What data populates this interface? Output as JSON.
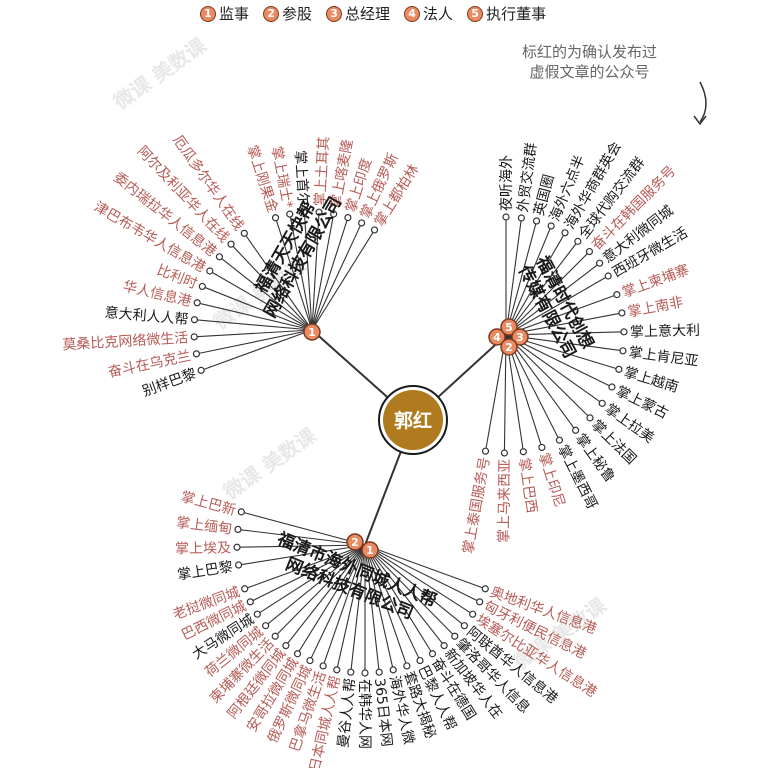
{
  "legend": [
    {
      "num": "1",
      "label": "监事"
    },
    {
      "num": "2",
      "label": "参股"
    },
    {
      "num": "3",
      "label": "总经理"
    },
    {
      "num": "4",
      "label": "法人"
    },
    {
      "num": "5",
      "label": "执行董事"
    }
  ],
  "note": [
    "标红的为确认发布过",
    "虚假文章的公众号"
  ],
  "center": {
    "label": "郭红"
  },
  "colors": {
    "red": "#b65b56",
    "black": "#1a1a1a",
    "center": "#b07a1f",
    "badge": "#e98a62",
    "line": "#333333"
  },
  "companies": [
    {
      "name_lines": [
        "福清天天快帮",
        "网络科技有限公司"
      ],
      "roles": [
        "1"
      ],
      "accounts": [
        {
          "label": "掌上刚果金",
          "red": true
        },
        {
          "label": "掌上瑞士*",
          "red": true
        },
        {
          "label": "掌上首尔",
          "red": false
        },
        {
          "label": "掌上土耳其",
          "red": true
        },
        {
          "label": "掌上喀麦隆",
          "red": true
        },
        {
          "label": "掌上印度",
          "red": true
        },
        {
          "label": "掌上俄罗斯",
          "red": true
        },
        {
          "label": "掌上都柏林",
          "red": true
        },
        {
          "label": "厄瓜多尔华人在线",
          "red": true
        },
        {
          "label": "阿尔及利亚华人在线",
          "red": true
        },
        {
          "label": "委内瑞拉华人信息港",
          "red": true
        },
        {
          "label": "津巴布韦华人信息港",
          "red": true
        },
        {
          "label": "比利时",
          "red": true
        },
        {
          "label": "华人信息港",
          "red": true
        },
        {
          "label": "意大利人人帮",
          "red": false
        },
        {
          "label": "莫桑比克网络微生活",
          "red": true
        },
        {
          "label": "奋斗在乌克兰",
          "red": true
        },
        {
          "label": "别样巴黎",
          "red": false
        }
      ]
    },
    {
      "name_lines": [
        "福清时代创想",
        "传媒有限公司"
      ],
      "roles": [
        "4",
        "5",
        "3",
        "2"
      ],
      "accounts": [
        {
          "label": "夜听海外",
          "red": false
        },
        {
          "label": "外贸交流群",
          "red": false
        },
        {
          "label": "英国圈",
          "red": false
        },
        {
          "label": "海外六点半",
          "red": false
        },
        {
          "label": "海外华商群英会",
          "red": false
        },
        {
          "label": "全球代购交流群",
          "red": false
        },
        {
          "label": "奋斗在韩国服务号",
          "red": true
        },
        {
          "label": "意大利微同城",
          "red": false
        },
        {
          "label": "西班牙微生活",
          "red": false
        },
        {
          "label": "掌上柬埔寨",
          "red": true
        },
        {
          "label": "掌上南非",
          "red": true
        },
        {
          "label": "掌上意大利",
          "red": false
        },
        {
          "label": "掌上肯尼亚",
          "red": false
        },
        {
          "label": "掌上越南",
          "red": false
        },
        {
          "label": "掌上蒙古",
          "red": false
        },
        {
          "label": "掌上拉美",
          "red": false
        },
        {
          "label": "掌上法国",
          "red": false
        },
        {
          "label": "掌上秘鲁",
          "red": false
        },
        {
          "label": "掌上墨西哥",
          "red": false
        },
        {
          "label": "掌上印尼",
          "red": true
        },
        {
          "label": "掌上巴西",
          "red": true
        },
        {
          "label": "掌上马来西亚",
          "red": true
        },
        {
          "label": "掌上泰国服务号",
          "red": true
        }
      ]
    },
    {
      "name_lines": [
        "福清市海外同城人人帮",
        "网络科技有限公司"
      ],
      "roles": [
        "2",
        "1"
      ],
      "accounts": [
        {
          "label": "掌上巴新",
          "red": true
        },
        {
          "label": "掌上缅甸",
          "red": true
        },
        {
          "label": "掌上埃及",
          "red": true
        },
        {
          "label": "掌上巴黎",
          "red": false
        },
        {
          "label": "老挝微同城",
          "red": true
        },
        {
          "label": "巴西微同城",
          "red": true
        },
        {
          "label": "大马微同城",
          "red": false
        },
        {
          "label": "荷兰微同城",
          "red": true
        },
        {
          "label": "柬埔寨微生活",
          "red": true
        },
        {
          "label": "阿根廷微同城",
          "red": true
        },
        {
          "label": "安哥拉微同城",
          "red": true
        },
        {
          "label": "俄罗斯微同城",
          "red": true
        },
        {
          "label": "巴拿马微生活",
          "red": true
        },
        {
          "label": "日本同城人人帮",
          "red": true
        },
        {
          "label": "曼谷人人帮",
          "red": false
        },
        {
          "label": "在韩华人网",
          "red": false
        },
        {
          "label": "365日本网",
          "red": false
        },
        {
          "label": "海外华人微",
          "red": false
        },
        {
          "label": "套路大揭秘",
          "red": false
        },
        {
          "label": "巴黎人人帮",
          "red": false
        },
        {
          "label": "奋斗在德国",
          "red": false
        },
        {
          "label": "新加坡华人在",
          "red": false
        },
        {
          "label": "肇洛哥华人信息",
          "red": false
        },
        {
          "label": "阿联酋华人信息港",
          "red": false
        },
        {
          "label": "埃塞尔比亚华人信息港",
          "red": true
        },
        {
          "label": "匈牙利便民信息港",
          "red": true
        },
        {
          "label": "奥地利华人信息港",
          "red": true
        }
      ]
    }
  ],
  "watermarks": [
    "微课 美数课",
    "微课 美数课",
    "微课 美数课",
    "微课 美数课"
  ]
}
